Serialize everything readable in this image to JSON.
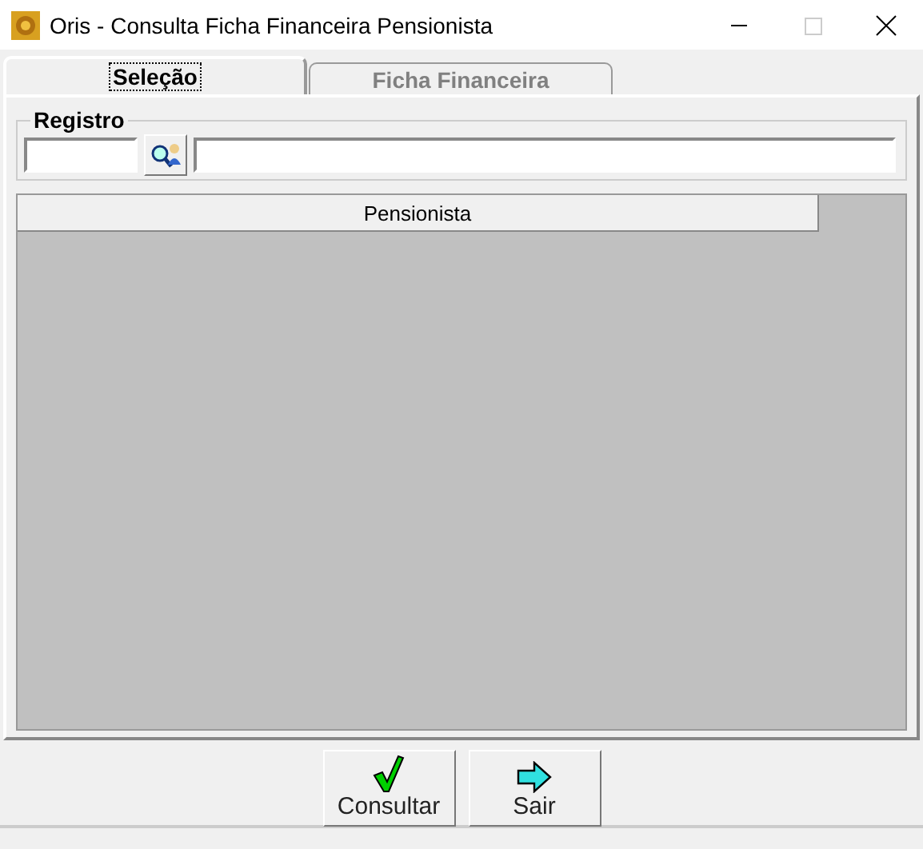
{
  "window": {
    "title": "Oris - Consulta Ficha Financeira Pensionista"
  },
  "tabs": [
    {
      "label": "Seleção",
      "selected": true
    },
    {
      "label": "Ficha Financeira",
      "selected": false
    }
  ],
  "registro": {
    "label": "Registro"
  },
  "table": {
    "columns": [
      "Pensionista"
    ]
  },
  "buttons": [
    {
      "label": "Consultar",
      "kind": "check"
    },
    {
      "label": "Sair",
      "kind": "arrow"
    }
  ]
}
